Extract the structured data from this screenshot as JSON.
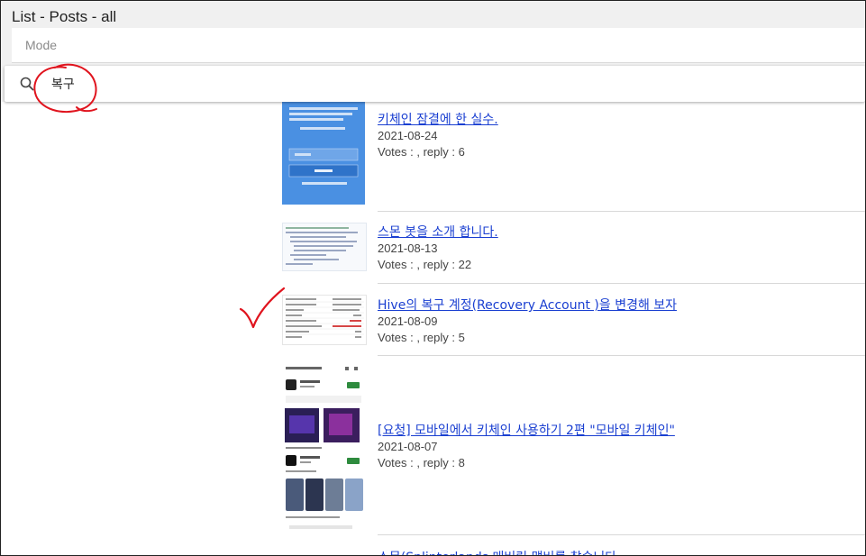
{
  "window": {
    "title": "List - Posts - all"
  },
  "mode": {
    "label": "Mode"
  },
  "search": {
    "value": "복구",
    "icon": "search-icon"
  },
  "annotation": {
    "circle_color": "#e0141e",
    "check_color": "#e0141e"
  },
  "posts": [
    {
      "title": "키체인 잠결에 한 실수.",
      "date": "2021-08-24",
      "votes": "Votes : , reply : 6"
    },
    {
      "title": "스몬 봇을 소개 합니다.",
      "date": "2021-08-13",
      "votes": "Votes : , reply : 22"
    },
    {
      "title": "Hive의 복구 계정(Recovery Account )을 변경해 보자",
      "date": "2021-08-09",
      "votes": "Votes : , reply : 5"
    },
    {
      "title": "[요청] 모바일에서 키체인 사용하기 2편 \"모바일 키체인\"",
      "date": "2021-08-07",
      "votes": "Votes : , reply : 8"
    },
    {
      "title": "스몬(Splinterlands 매버릭 맵버를 찾습니다"
    }
  ],
  "colors": {
    "link": "#1a3fd1",
    "header_bg": "#f0f0f0",
    "thumb_blue": "#4a90e2"
  }
}
